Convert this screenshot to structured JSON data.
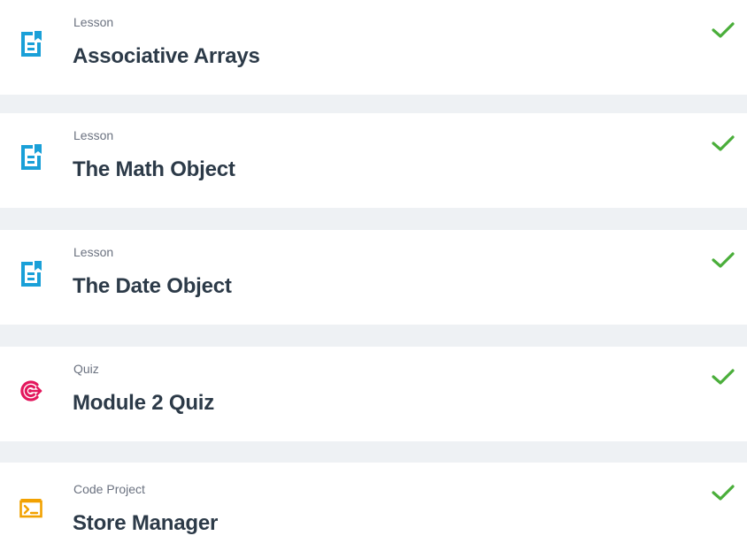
{
  "items": [
    {
      "type": "Lesson",
      "title": "Associative Arrays",
      "icon": "lesson-icon",
      "completed": true
    },
    {
      "type": "Lesson",
      "title": "The Math Object",
      "icon": "lesson-icon",
      "completed": true
    },
    {
      "type": "Lesson",
      "title": "The Date Object",
      "icon": "lesson-icon",
      "completed": true
    },
    {
      "type": "Quiz",
      "title": "Module 2 Quiz",
      "icon": "quiz-target-icon",
      "completed": true
    },
    {
      "type": "Code Project",
      "title": "Store Manager",
      "icon": "code-terminal-icon",
      "completed": true
    }
  ],
  "colors": {
    "lesson": "#1aa0d8",
    "quiz": "#e3175d",
    "code_project": "#f2a100",
    "check": "#4aae3a",
    "title": "#2c3a48",
    "type": "#6b7280",
    "background": "#eef1f4"
  }
}
